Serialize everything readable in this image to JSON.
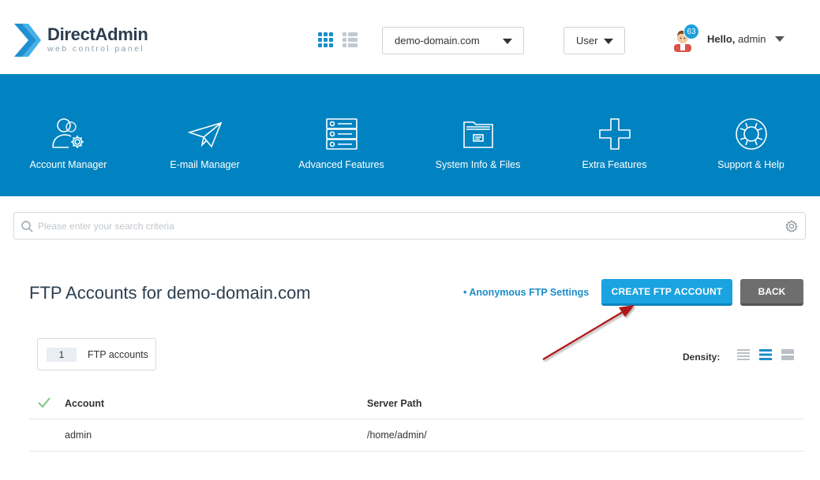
{
  "header": {
    "logo_title": "DirectAdmin",
    "logo_subtitle": "web control panel",
    "domain_selected": "demo-domain.com",
    "role_selected": "User",
    "notification_count": "63",
    "greeting": "Hello,",
    "username": "admin",
    "colors": {
      "brand_dark": "#2c3e50",
      "accent": "#1aa0d9"
    }
  },
  "nav": {
    "background": "#0083c0",
    "items": [
      {
        "label": "Account Manager",
        "icon": "account-manager-icon"
      },
      {
        "label": "E-mail Manager",
        "icon": "paper-plane-icon"
      },
      {
        "label": "Advanced Features",
        "icon": "server-stack-icon"
      },
      {
        "label": "System Info & Files",
        "icon": "folder-icon"
      },
      {
        "label": "Extra Features",
        "icon": "plus-icon"
      },
      {
        "label": "Support & Help",
        "icon": "lifebuoy-icon"
      }
    ]
  },
  "search": {
    "placeholder": "Please enter your search criteria",
    "value": ""
  },
  "page": {
    "title": "FTP Accounts for demo-domain.com",
    "anon_link": "• Anonymous FTP Settings",
    "create_button": "CREATE FTP ACCOUNT",
    "back_button": "BACK",
    "count": "1",
    "count_label": "FTP accounts",
    "density_label": "Density:",
    "density_selected": "medium"
  },
  "table": {
    "headers": [
      "Account",
      "Server Path"
    ],
    "rows": [
      {
        "account": "admin",
        "path": "/home/admin/"
      }
    ]
  }
}
